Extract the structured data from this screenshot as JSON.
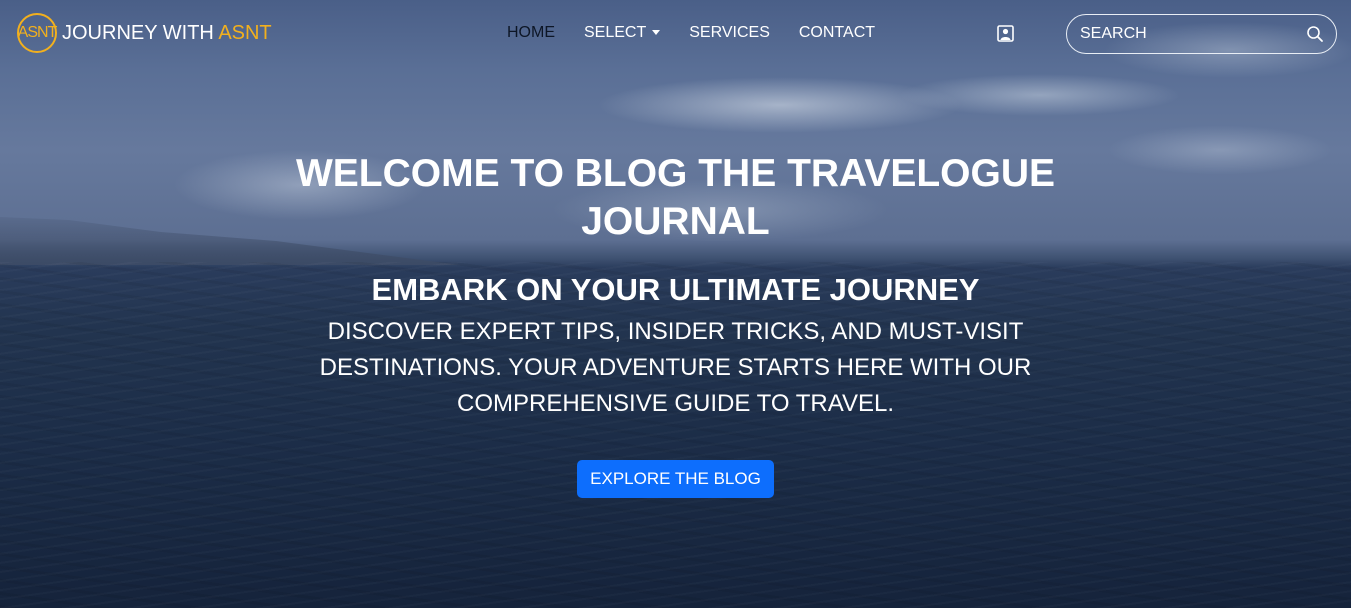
{
  "brand": {
    "logo_text": "ASNT",
    "name": "JOURNEY WITH ",
    "accent": "ASNT",
    "accent_color": "#f2b01e"
  },
  "nav": {
    "items": [
      {
        "label": "HOME",
        "active": true
      },
      {
        "label": "SELECT",
        "dropdown": true
      },
      {
        "label": "SERVICES"
      },
      {
        "label": "CONTACT"
      }
    ],
    "profile_icon": "user-profile-icon"
  },
  "search": {
    "placeholder": "SEARCH",
    "icon": "search-icon"
  },
  "hero": {
    "title": "WELCOME TO BLOG THE TRAVELOGUE JOURNAL",
    "subtitle": "EMBARK ON YOUR ULTIMATE JOURNEY",
    "description": "DISCOVER EXPERT TIPS, INSIDER TRICKS, AND MUST-VISIT DESTINATIONS. YOUR ADVENTURE STARTS HERE WITH OUR COMPREHENSIVE GUIDE TO TRAVEL.",
    "cta_label": "EXPLORE THE BLOG",
    "cta_color": "#0d6efd"
  }
}
